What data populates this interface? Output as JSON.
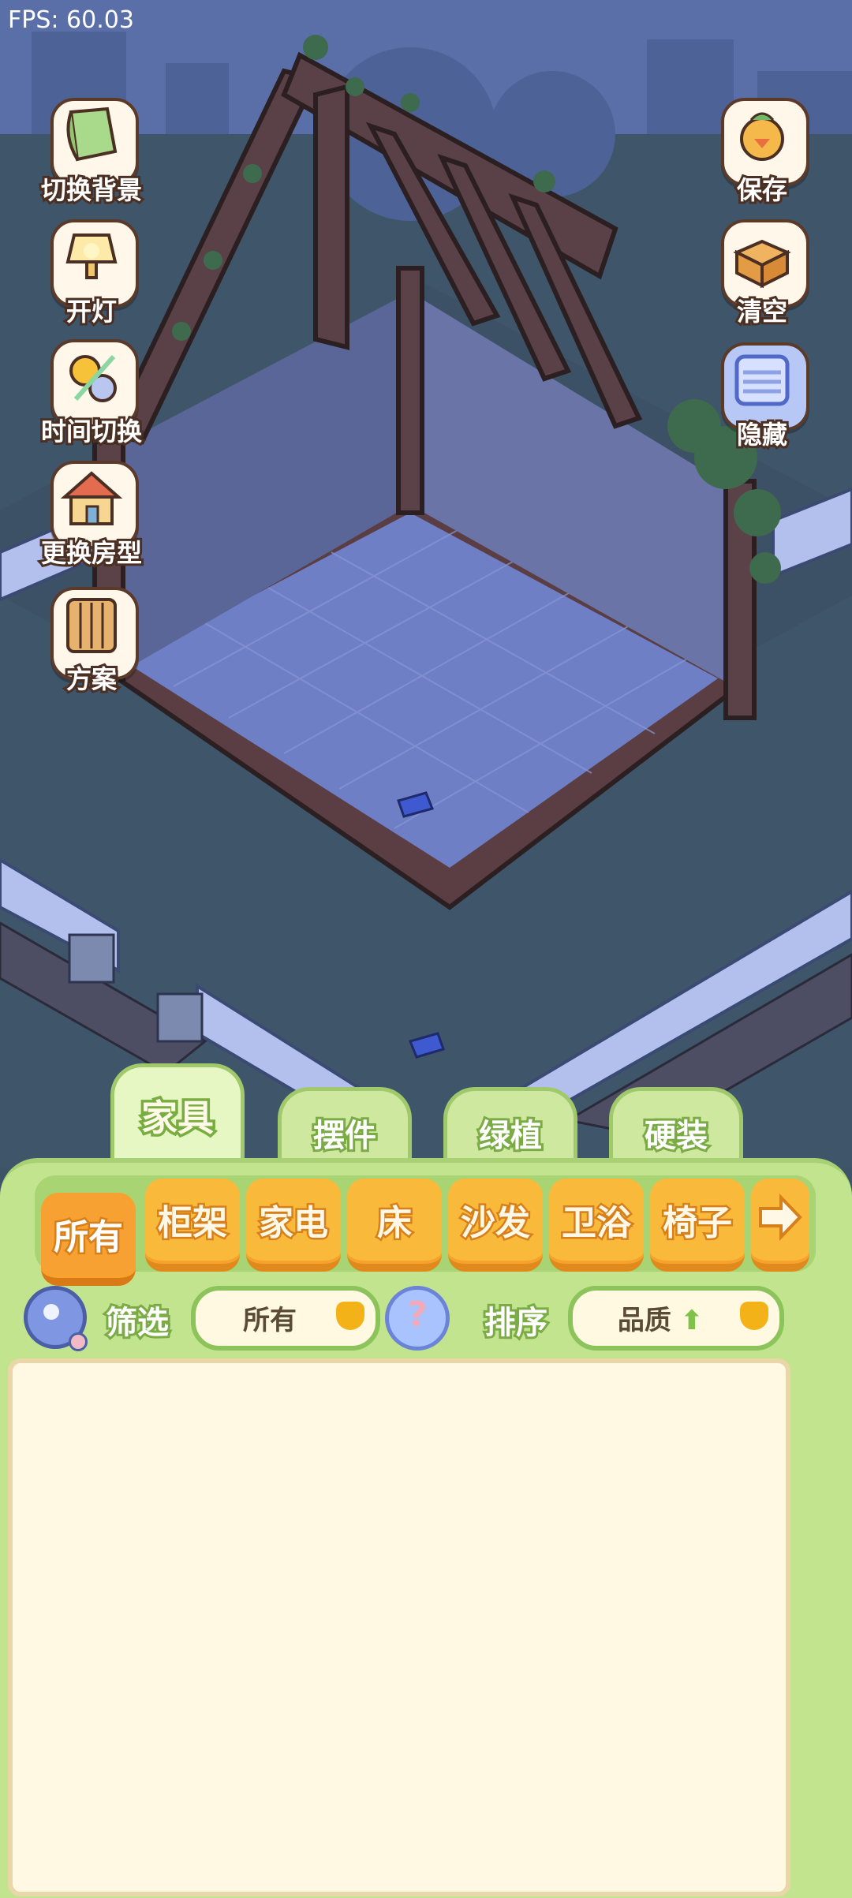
{
  "fps": "FPS: 60.03",
  "left_buttons": [
    {
      "label": "切换背景",
      "icon": "wallpaper-roll-icon"
    },
    {
      "label": "开灯",
      "icon": "lamp-icon"
    },
    {
      "label": "时间切换",
      "icon": "sun-moon-icon"
    },
    {
      "label": "更换房型",
      "icon": "house-icon"
    },
    {
      "label": "方案",
      "icon": "plans-crate-icon"
    }
  ],
  "right_buttons": [
    {
      "label": "保存",
      "icon": "chick-save-icon"
    },
    {
      "label": "清空",
      "icon": "box-clear-icon"
    },
    {
      "label": "隐藏",
      "icon": "hide-frame-icon"
    }
  ],
  "main_tabs": [
    "家具",
    "摆件",
    "绿植",
    "硬装"
  ],
  "active_main_tab": "家具",
  "categories": [
    "所有",
    "柜架",
    "家电",
    "床",
    "沙发",
    "卫浴",
    "椅子"
  ],
  "active_category": "所有",
  "filter": {
    "label": "筛选",
    "value": "所有"
  },
  "sort": {
    "label": "排序",
    "value": "品质",
    "direction": "up"
  },
  "colors": {
    "panel": "#c3e48f",
    "tab_orange": "#f9b93a",
    "list_bg": "#fff8e2",
    "night_bg": "#3d5368"
  }
}
